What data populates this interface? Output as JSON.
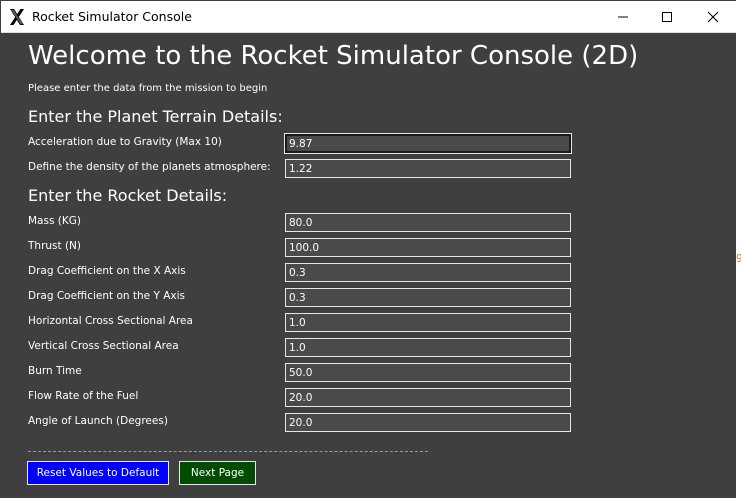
{
  "window": {
    "title": "Rocket Simulator Console",
    "app_icon": "x-logo-icon"
  },
  "header": {
    "title": "Welcome to the Rocket Simulator Console (2D)",
    "subtitle": "Please enter the data from the mission to begin"
  },
  "planet": {
    "heading": "Enter the Planet Terrain Details:",
    "fields": [
      {
        "label": "Acceleration due to Gravity (Max 10)",
        "value": "9.87"
      },
      {
        "label": "Define the density of the planets atmosphere:",
        "value": "1.22"
      }
    ]
  },
  "rocket": {
    "heading": "Enter the Rocket Details:",
    "fields": [
      {
        "label": "Mass (KG)",
        "value": "80.0"
      },
      {
        "label": "Thrust (N)",
        "value": "100.0"
      },
      {
        "label": "Drag Coefficient on the X Axis",
        "value": "0.3"
      },
      {
        "label": "Drag Coefficient on the Y Axis",
        "value": "0.3"
      },
      {
        "label": "Horizontal Cross Sectional Area",
        "value": "1.0"
      },
      {
        "label": "Vertical Cross Sectional Area",
        "value": "1.0"
      },
      {
        "label": "Burn Time",
        "value": "50.0"
      },
      {
        "label": "Flow Rate of the Fuel",
        "value": "20.0"
      },
      {
        "label": "Angle of Launch (Degrees)",
        "value": "20.0"
      }
    ]
  },
  "actions": {
    "reset_label": "Reset Values to Default",
    "next_label": "Next Page"
  },
  "background_peek": "9",
  "colors": {
    "window_bg": "#3f3f3f",
    "input_bg": "#4a4a4a",
    "reset_button": "#0000ff",
    "next_button": "#004c00"
  }
}
